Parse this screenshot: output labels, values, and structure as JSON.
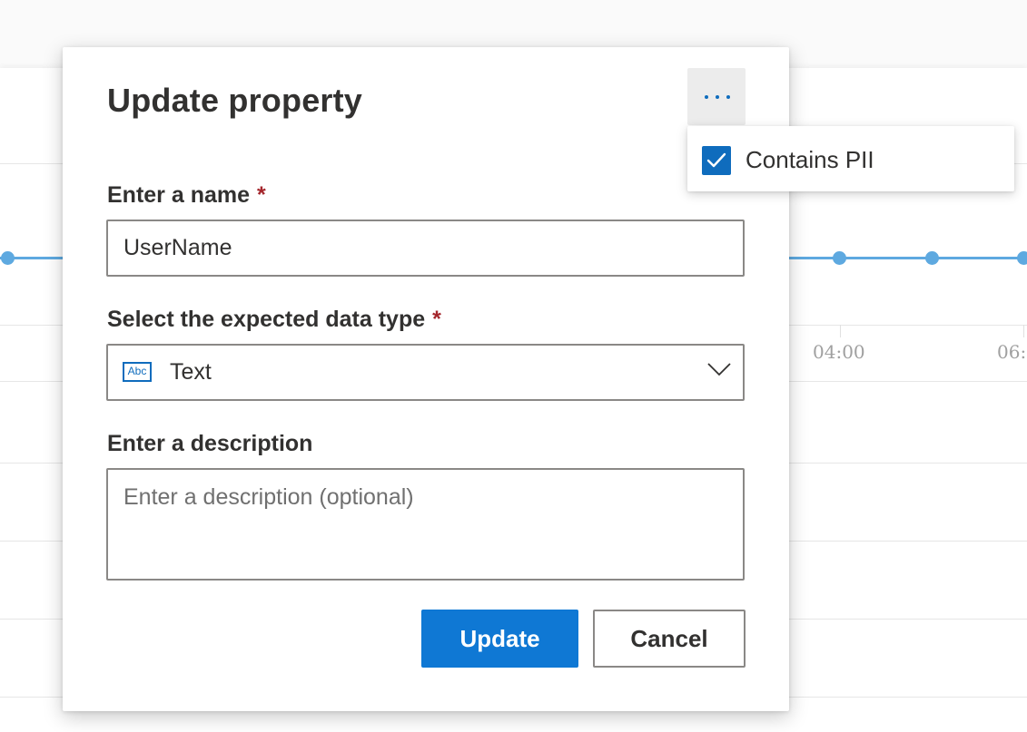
{
  "background": {
    "axis_tick_labels": [
      "04:00",
      "06:"
    ],
    "series_color": "#5ea9e0"
  },
  "dialog": {
    "title": "Update property",
    "more_icon": "more-horizontal-icon",
    "name_field": {
      "label": "Enter a name",
      "required_mark": "*",
      "value": "UserName"
    },
    "data_type_field": {
      "label": "Select the expected data type",
      "required_mark": "*",
      "selected_icon": "abc-text-icon",
      "selected_icon_text": "Abc",
      "selected_value": "Text"
    },
    "description_field": {
      "label": "Enter a description",
      "placeholder": "Enter a description (optional)",
      "value": ""
    },
    "buttons": {
      "update": "Update",
      "cancel": "Cancel"
    }
  },
  "overflow_menu": {
    "items": [
      {
        "label": "Contains PII",
        "checked": true
      }
    ]
  },
  "colors": {
    "accent": "#0f6cbd",
    "primary_button": "#0f78d4",
    "required": "#a4262c",
    "border": "#8a8886"
  }
}
